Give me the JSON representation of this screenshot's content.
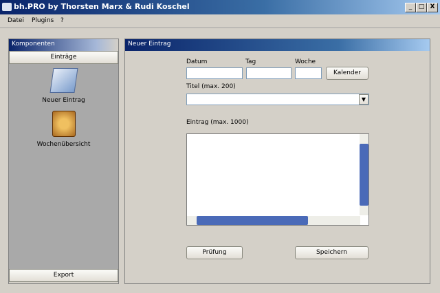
{
  "window": {
    "title": "bh.PRO by Thorsten Marx & Rudi Koschel",
    "min": "_",
    "max": "□",
    "close": "X"
  },
  "menu": [
    "Datei",
    "Plugins",
    "?"
  ],
  "sidebar": {
    "title": "Komponenten",
    "section": "Einträge",
    "items": [
      {
        "label": "Neuer Eintrag"
      },
      {
        "label": "Wochenübersicht"
      }
    ],
    "bottom": "Export"
  },
  "form": {
    "title": "Neuer Eintrag",
    "datum": "Datum",
    "tag": "Tag",
    "woche": "Woche",
    "kalender": "Kalender",
    "titel": "Titel (max. 200)",
    "eintrag": "Eintrag (max. 1000)",
    "pruefung": "Prüfung",
    "speichern": "Speichern"
  }
}
